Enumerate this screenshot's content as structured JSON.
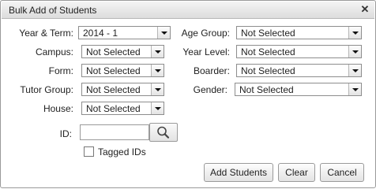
{
  "dialog": {
    "title": "Bulk Add of Students",
    "close_glyph": "✕"
  },
  "fields": {
    "year_term": {
      "label": "Year & Term:",
      "value": "2014 - 1"
    },
    "campus": {
      "label": "Campus:",
      "value": "Not Selected"
    },
    "form": {
      "label": "Form:",
      "value": "Not Selected"
    },
    "tutor_group": {
      "label": "Tutor Group:",
      "value": "Not Selected"
    },
    "house": {
      "label": "House:",
      "value": "Not Selected"
    },
    "age_group": {
      "label": "Age Group:",
      "value": "Not Selected"
    },
    "year_level": {
      "label": "Year Level:",
      "value": "Not Selected"
    },
    "boarder": {
      "label": "Boarder:",
      "value": "Not Selected"
    },
    "gender": {
      "label": "Gender:",
      "value": "Not Selected"
    },
    "id": {
      "label": "ID:",
      "value": ""
    },
    "tagged_ids": {
      "label": "Tagged IDs",
      "checked": false
    }
  },
  "buttons": {
    "add_students": "Add Students",
    "clear": "Clear",
    "cancel": "Cancel"
  },
  "icons": {
    "search": "search-icon",
    "close": "close-icon",
    "dropdown": "chevron-down-icon"
  }
}
